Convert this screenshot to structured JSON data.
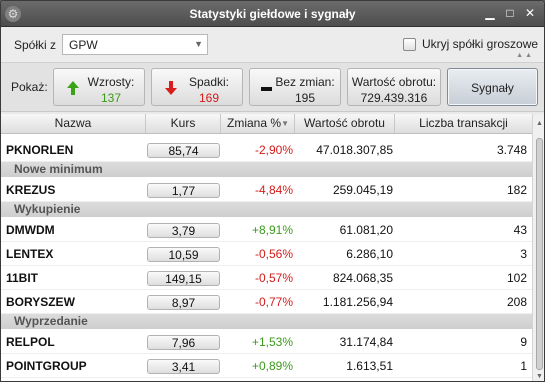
{
  "window": {
    "title": "Statystyki giełdowe i sygnały"
  },
  "filter": {
    "label": "Spółki z",
    "selected": "GPW",
    "hide_label": "Ukryj spółki groszowe"
  },
  "show": {
    "label": "Pokaż:",
    "up": {
      "label": "Wzrosty:",
      "value": "137"
    },
    "down": {
      "label": "Spadki:",
      "value": "169"
    },
    "unchanged": {
      "label": "Bez zmian:",
      "value": "195"
    },
    "turnover": {
      "label": "Wartość obrotu:",
      "value": "729.439.316"
    },
    "signals": {
      "label": "Sygnały"
    }
  },
  "table": {
    "columns": [
      "Nazwa",
      "Kurs",
      "Zmiana %",
      "Wartość obrotu",
      "Liczba transakcji"
    ],
    "rows": [
      {
        "name": "PKNORLEN",
        "kurs": "85,74",
        "chg": "-2,90%",
        "val": "47.018.307,85",
        "tx": "3.748"
      },
      {
        "section": "Nowe minimum"
      },
      {
        "name": "KREZUS",
        "kurs": "1,77",
        "chg": "-4,84%",
        "val": "259.045,19",
        "tx": "182"
      },
      {
        "section": "Wykupienie"
      },
      {
        "name": "DMWDM",
        "kurs": "3,79",
        "chg": "+8,91%",
        "val": "61.081,20",
        "tx": "43"
      },
      {
        "name": "LENTEX",
        "kurs": "10,59",
        "chg": "-0,56%",
        "val": "6.286,10",
        "tx": "3"
      },
      {
        "name": "11BIT",
        "kurs": "149,15",
        "chg": "-0,57%",
        "val": "824.068,35",
        "tx": "102"
      },
      {
        "name": "BORYSZEW",
        "kurs": "8,97",
        "chg": "-0,77%",
        "val": "1.181.256,94",
        "tx": "208"
      },
      {
        "section": "Wyprzedanie"
      },
      {
        "name": "RELPOL",
        "kurs": "7,96",
        "chg": "+1,53%",
        "val": "31.174,84",
        "tx": "9"
      },
      {
        "name": "POINTGROUP",
        "kurs": "3,41",
        "chg": "+0,89%",
        "val": "1.613,51",
        "tx": "1"
      }
    ]
  },
  "colors": {
    "positive": "#3c9a1c",
    "negative": "#d21b1b"
  }
}
